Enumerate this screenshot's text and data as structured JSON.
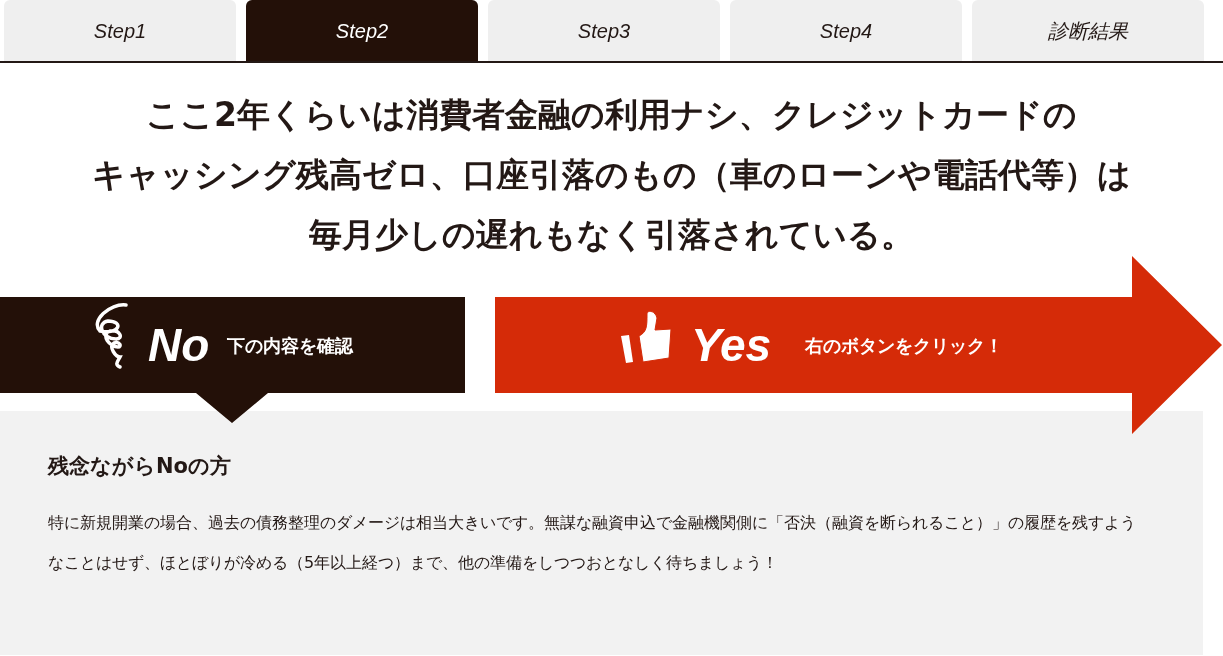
{
  "tabs": [
    {
      "label": "Step1",
      "selected": false
    },
    {
      "label": "Step2",
      "selected": true
    },
    {
      "label": "Step3",
      "selected": false
    },
    {
      "label": "Step4",
      "selected": false
    },
    {
      "label": "診断結果",
      "selected": false
    }
  ],
  "question": {
    "lines": [
      "ここ**2年**くらいは**消費者金融**の利用ナシ、クレジットカードの",
      "**キャッシング残高ゼロ**、口座引落のもの（車のローンや電話代等）は",
      "**毎月少しの遅れもなく引落**されている。"
    ]
  },
  "answers": {
    "no": {
      "label": "No",
      "caption": "下の内容を確認"
    },
    "yes": {
      "label": "Yes",
      "caption": "右のボタンをクリック！"
    }
  },
  "result": {
    "heading": "残念ながらNoの方",
    "body": "特に新規開業の場合、過去の債務整理のダメージは相当大きいです。無謀な融資申込で金融機関側に「否決（融資を断られること）」の履歴を残すようなことはせず、ほとぼりが冷める（5年以上経つ）まで、他の準備をしつつおとなしく待ちましょう！"
  }
}
